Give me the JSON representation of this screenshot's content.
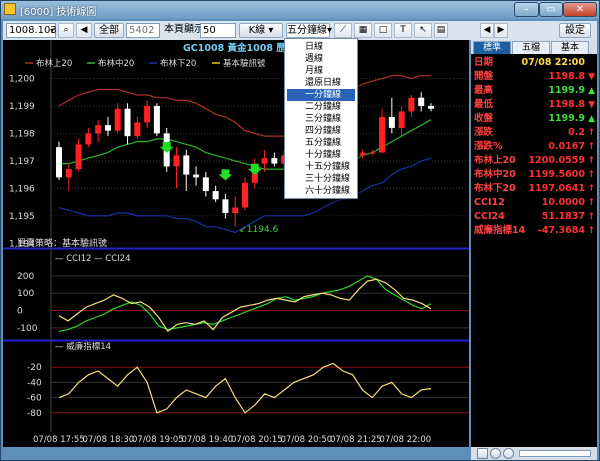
{
  "window": {
    "title": "[6000] 技術線圖"
  },
  "toolbar": {
    "symbol": "1008.103",
    "range_btn": "全部",
    "count_value": "5402",
    "page_label": "本頁顯示",
    "page_value": "50",
    "kline_btn": "K線",
    "interval_btn": "五分鐘線",
    "settings_btn": "設定"
  },
  "interval_menu": {
    "items": [
      "日線",
      "週線",
      "月線",
      "還原日線",
      "一分鐘線",
      "二分鐘線",
      "三分鐘線",
      "四分鐘線",
      "五分鐘線",
      "十分鐘線",
      "十五分鐘線",
      "三十分鐘線",
      "六十分鐘線"
    ],
    "selected": "一分鐘線"
  },
  "main_panel": {
    "title": "GC1008 黃金1008  歷史走勢",
    "legend": {
      "upper": "布林上20",
      "middle": "布林中20",
      "lower": "布林下20",
      "signal": "基本驗訊號"
    },
    "y_ticks": [
      "1,200",
      "1,199",
      "1,198",
      "1,197",
      "1,196",
      "1,195",
      "1,194"
    ],
    "low_marker": "1194.6"
  },
  "strategy_panel": {
    "title": "買賣策略：基本驗訊號"
  },
  "cci_panel": {
    "legend": [
      "CCI12",
      "CCI24"
    ],
    "y_ticks": [
      "200",
      "100",
      "0",
      "-100"
    ]
  },
  "osc_panel": {
    "legend": "威廉指標14",
    "y_ticks": [
      "-20",
      "-40",
      "-60",
      "-80"
    ]
  },
  "x_ticks": [
    "07/08 17:55",
    "07/08 18:30",
    "07/08 19:05",
    "07/08 19:40",
    "07/08 20:15",
    "07/08 20:50",
    "07/08 21:25",
    "07/08 22:00"
  ],
  "quote_tabs": [
    "標準",
    "五檔",
    "基本"
  ],
  "quote": [
    {
      "label": "日期",
      "value": "07/08 22:00",
      "arrow": ""
    },
    {
      "label": "開盤",
      "value": "1198.8",
      "arrow": "▼"
    },
    {
      "label": "最高",
      "value": "1199.9",
      "arrow": "▲"
    },
    {
      "label": "最低",
      "value": "1198.8",
      "arrow": "▼"
    },
    {
      "label": "收盤",
      "value": "1199.9",
      "arrow": "▲"
    },
    {
      "label": "漲跌",
      "value": "0.2",
      "arrow": "↑"
    },
    {
      "label": "漲跌%",
      "value": "0.0167",
      "arrow": "↑"
    },
    {
      "label": "布林上20",
      "value": "1200.0559",
      "arrow": "↑"
    },
    {
      "label": "布林中20",
      "value": "1199.5600",
      "arrow": "↑"
    },
    {
      "label": "布林下20",
      "value": "1197.0641",
      "arrow": "↑"
    },
    {
      "label": "CCI12",
      "value": "10.0000",
      "arrow": "↑"
    },
    {
      "label": "CCI24",
      "value": "51.1837",
      "arrow": "↑"
    },
    {
      "label": "威廉指標14",
      "value": "-47.3684",
      "arrow": "↑"
    }
  ],
  "chart_data": {
    "type": "candlestick",
    "ohlc": [
      [
        1197.5,
        1197.7,
        1196.3,
        1196.4
      ],
      [
        1196.4,
        1196.9,
        1195.9,
        1196.7
      ],
      [
        1196.7,
        1197.8,
        1196.6,
        1197.6
      ],
      [
        1197.6,
        1198.2,
        1197.5,
        1198.0
      ],
      [
        1198.0,
        1198.5,
        1197.7,
        1198.3
      ],
      [
        1198.3,
        1198.6,
        1197.9,
        1198.1
      ],
      [
        1198.1,
        1199.1,
        1198.0,
        1198.9
      ],
      [
        1198.9,
        1199.1,
        1197.6,
        1197.9
      ],
      [
        1197.9,
        1198.6,
        1197.8,
        1198.4
      ],
      [
        1198.4,
        1199.2,
        1198.2,
        1199.0
      ],
      [
        1199.0,
        1199.1,
        1197.9,
        1198.0
      ],
      [
        1198.0,
        1198.2,
        1196.6,
        1196.8
      ],
      [
        1196.8,
        1197.5,
        1196.0,
        1197.2
      ],
      [
        1197.2,
        1197.4,
        1195.9,
        1196.5
      ],
      [
        1196.5,
        1196.8,
        1196.1,
        1196.4
      ],
      [
        1196.4,
        1196.6,
        1195.7,
        1195.9
      ],
      [
        1195.9,
        1196.1,
        1195.5,
        1195.6
      ],
      [
        1195.6,
        1195.8,
        1194.9,
        1195.1
      ],
      [
        1195.1,
        1195.7,
        1194.6,
        1195.3
      ],
      [
        1195.3,
        1196.4,
        1195.2,
        1196.2
      ],
      [
        1196.2,
        1197.1,
        1196.0,
        1196.9
      ],
      [
        1196.9,
        1197.4,
        1196.6,
        1197.1
      ],
      [
        1197.1,
        1197.3,
        1196.8,
        1196.9
      ],
      [
        1196.9,
        1197.4,
        1196.8,
        1197.2
      ],
      [
        1197.2,
        1197.5,
        1196.8,
        1196.9
      ],
      [
        1196.9,
        1197.4,
        1196.8,
        1197.2
      ],
      [
        1197.2,
        1197.6,
        1196.4,
        1196.6
      ],
      [
        1196.6,
        1197.2,
        1196.5,
        1197.1
      ],
      [
        1197.1,
        1198.0,
        1197.0,
        1197.8
      ],
      [
        1197.8,
        1198.1,
        1197.1,
        1197.3
      ],
      [
        1197.3,
        1197.6,
        1196.9,
        1197.2
      ],
      [
        1197.2,
        1197.4,
        1197.1,
        1197.3
      ],
      [
        1197.3,
        1197.4,
        1197.2,
        1197.3
      ],
      [
        1197.3,
        1198.9,
        1197.3,
        1198.6
      ],
      [
        1198.6,
        1199.3,
        1198.0,
        1198.2
      ],
      [
        1198.2,
        1199.0,
        1197.9,
        1198.8
      ],
      [
        1198.8,
        1199.4,
        1198.6,
        1199.3
      ],
      [
        1199.3,
        1199.5,
        1198.8,
        1199.0
      ],
      [
        1199.0,
        1199.1,
        1198.8,
        1198.9
      ]
    ],
    "y_range": [
      1193.9,
      1200.6
    ],
    "bollinger_upper": [
      1199.0,
      1199.2,
      1199.4,
      1199.5,
      1199.6,
      1199.6,
      1199.6,
      1199.5,
      1199.4,
      1199.4,
      1199.3,
      1199.3,
      1199.2,
      1199.2,
      1199.1,
      1198.9,
      1198.7,
      1198.6,
      1198.4,
      1198.1,
      1198.0,
      1197.9,
      1197.9,
      1197.9,
      1197.9,
      1198.1,
      1198.4,
      1198.7,
      1199.1,
      1199.4,
      1199.6,
      1199.8,
      1199.9,
      1200.0,
      1200.1,
      1200.1,
      1200.0,
      1200.1,
      1200.1
    ],
    "bollinger_middle": [
      1196.9,
      1196.9,
      1197.0,
      1197.1,
      1197.2,
      1197.3,
      1197.5,
      1197.6,
      1197.7,
      1197.7,
      1197.8,
      1197.8,
      1197.7,
      1197.6,
      1197.5,
      1197.3,
      1197.2,
      1197.1,
      1197.0,
      1196.9,
      1196.8,
      1196.7,
      1196.7,
      1196.7,
      1196.6,
      1196.6,
      1196.6,
      1196.7,
      1196.8,
      1196.9,
      1197.0,
      1197.2,
      1197.3,
      1197.5,
      1197.7,
      1197.9,
      1198.1,
      1198.3,
      1198.5
    ],
    "bollinger_lower": [
      1195.3,
      1195.2,
      1195.1,
      1195.0,
      1195.0,
      1195.0,
      1195.1,
      1195.1,
      1195.0,
      1195.0,
      1195.0,
      1195.0,
      1194.9,
      1194.9,
      1194.8,
      1194.6,
      1194.6,
      1194.5,
      1194.4,
      1194.6,
      1194.8,
      1195.0,
      1195.0,
      1195.0,
      1195.0,
      1195.0,
      1195.1,
      1195.3,
      1195.5,
      1195.6,
      1195.7,
      1195.9,
      1196.1,
      1196.2,
      1196.5,
      1196.7,
      1196.8,
      1197.0,
      1197.1
    ],
    "signal_arrows": [
      {
        "i": 11,
        "dir": "down",
        "price": 1197.4
      },
      {
        "i": 17,
        "dir": "down",
        "price": 1196.4
      },
      {
        "i": 20,
        "dir": "down",
        "price": 1196.6
      }
    ],
    "cci12": [
      -30,
      -60,
      -20,
      20,
      40,
      60,
      90,
      70,
      40,
      50,
      20,
      -40,
      -120,
      -80,
      -70,
      -80,
      -60,
      -110,
      -40,
      -10,
      20,
      30,
      40,
      60,
      70,
      60,
      50,
      80,
      90,
      100,
      90,
      70,
      60,
      120,
      170,
      180,
      160,
      120,
      70,
      60,
      40,
      10
    ],
    "cci24": [
      -120,
      -110,
      -90,
      -60,
      -40,
      -20,
      10,
      30,
      50,
      30,
      -20,
      -90,
      -110,
      -100,
      -90,
      -80,
      -70,
      -80,
      -60,
      -40,
      -20,
      0,
      20,
      40,
      70,
      80,
      60,
      70,
      80,
      100,
      110,
      120,
      140,
      170,
      200,
      180,
      120,
      90,
      60,
      30,
      10,
      40
    ],
    "cci_range": [
      -170,
      280
    ],
    "williams": [
      -60,
      -55,
      -40,
      -30,
      -25,
      -35,
      -45,
      -30,
      -20,
      -40,
      -80,
      -75,
      -60,
      -50,
      -55,
      -60,
      -45,
      -35,
      -60,
      -80,
      -70,
      -55,
      -60,
      -50,
      -40,
      -35,
      -30,
      -20,
      -15,
      -25,
      -30,
      -50,
      -60,
      -45,
      -40,
      -55,
      -60,
      -50,
      -48
    ],
    "wr_range": [
      -100,
      0
    ]
  }
}
